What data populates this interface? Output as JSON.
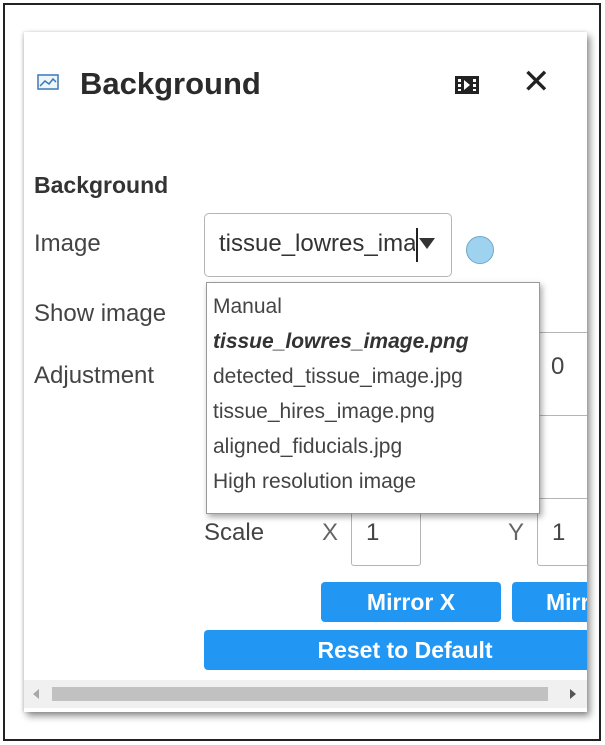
{
  "panel": {
    "title": "Background",
    "icon": "image-icon",
    "dock_icon": "dock-panel-icon",
    "close_icon": "close-icon"
  },
  "section": {
    "heading": "Background"
  },
  "fields": {
    "image_label": "Image",
    "show_image_label": "Show image",
    "adjustment_label": "Adjustment",
    "scale_label": "Scale"
  },
  "image_select": {
    "value": "tissue_lowres_image.png",
    "status_color": "#9fd2ef",
    "options": [
      "Manual",
      "tissue_lowres_image.png",
      "detected_tissue_image.jpg",
      "tissue_hires_image.png",
      "aligned_fiducials.jpg",
      "High resolution image"
    ],
    "selected_index": 1
  },
  "adjustment": {
    "value": "0"
  },
  "scale": {
    "x_label": "X",
    "x_value": "1",
    "y_label": "Y",
    "y_value": "1"
  },
  "buttons": {
    "mirror_x": "Mirror X",
    "mirror_y": "Mirror Y",
    "reset": "Reset to Default"
  },
  "colors": {
    "accent": "#2196f3",
    "text": "#333333"
  }
}
